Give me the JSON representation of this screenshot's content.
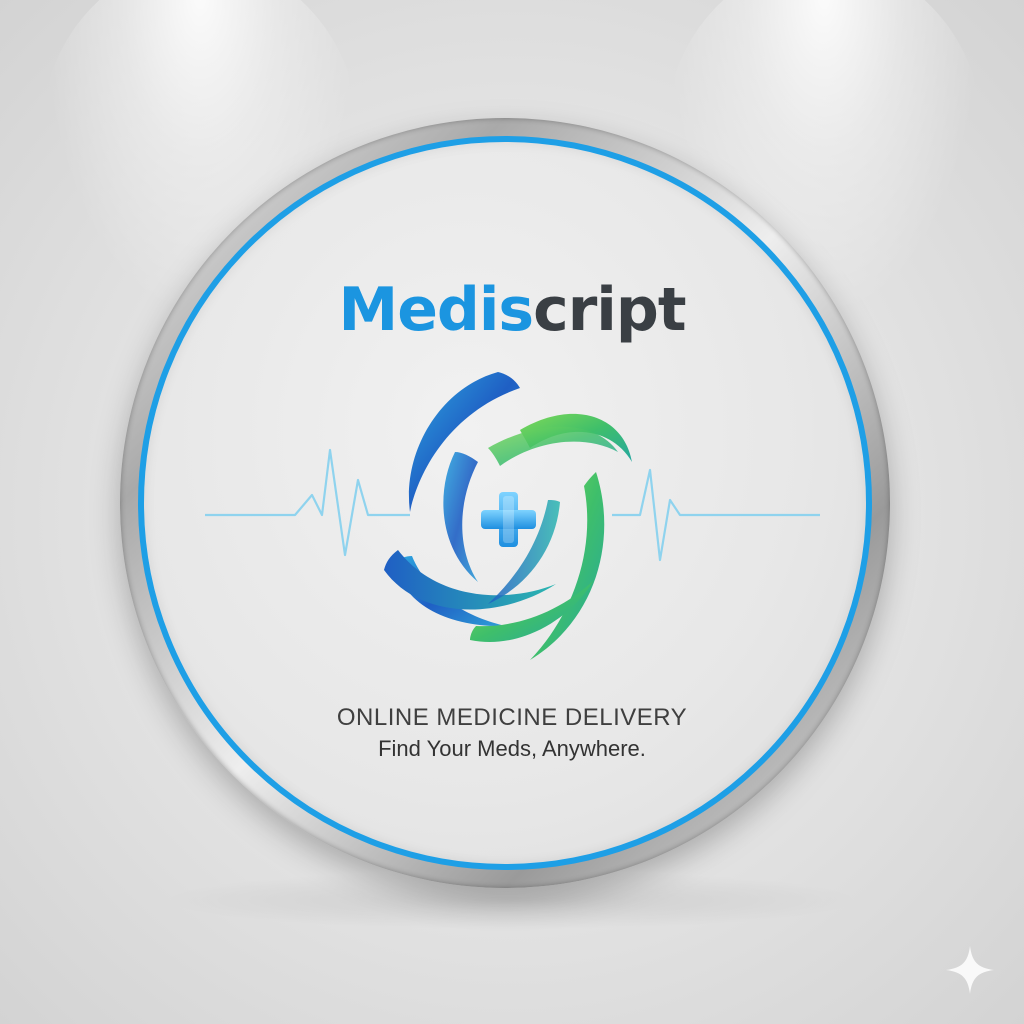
{
  "brand": {
    "name_part1": "Medis",
    "name_part2": "cript"
  },
  "tagline": {
    "line1": "ONLINE MEDICINE DELIVERY",
    "line2": "Find Your Meds, Anywhere."
  },
  "icons": {
    "emblem": "swirl-medical-cross-icon",
    "heartbeat": "heartbeat-line-icon",
    "corner": "sparkle-icon"
  },
  "colors": {
    "accent_blue": "#1e9fe6",
    "brand_blue": "#1b95e0",
    "brand_dark": "#3a3f44",
    "swirl_blue": "#1f5fc4",
    "swirl_green": "#5bcf3a",
    "cross_blue": "#2a9fe8"
  }
}
